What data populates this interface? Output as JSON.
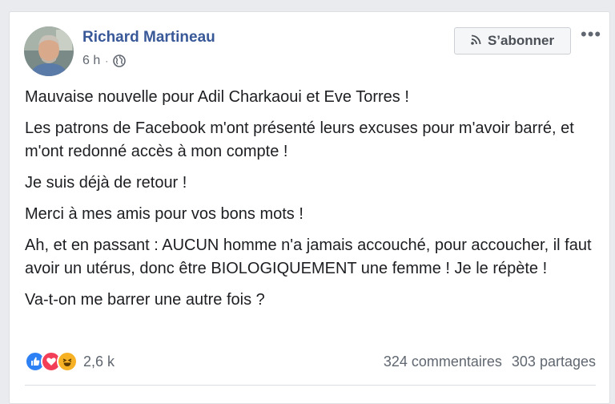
{
  "post": {
    "author": "Richard Martineau",
    "time": "6 h",
    "separator": "·",
    "audience_icon": "globe-icon",
    "follow_icon": "rss-icon",
    "follow_label": "S’abonner",
    "more_label": "•••",
    "paragraphs": [
      "Mauvaise nouvelle pour Adil Charkaoui et Eve Torres !",
      "Les patrons de Facebook m'ont présenté leurs excuses pour m'avoir barré, et m'ont redonné accès à mon compte !",
      "Je suis déjà de retour !",
      "Merci à mes amis pour vos bons mots !",
      "Ah, et en passant : AUCUN homme n'a jamais accouché, pour accoucher, il faut avoir un utérus, donc être BIOLOGIQUEMENT une femme ! Je le répète !",
      "Va-t-on me barrer une autre fois ?"
    ]
  },
  "reactions": {
    "icons": [
      "like-icon",
      "love-icon",
      "haha-icon"
    ],
    "count": "2,6 k",
    "colors": {
      "like": "#2e81f4",
      "love": "#f33e58",
      "haha": "#f7b125"
    }
  },
  "stats": {
    "comments": "324 commentaires",
    "shares": "303 partages"
  }
}
